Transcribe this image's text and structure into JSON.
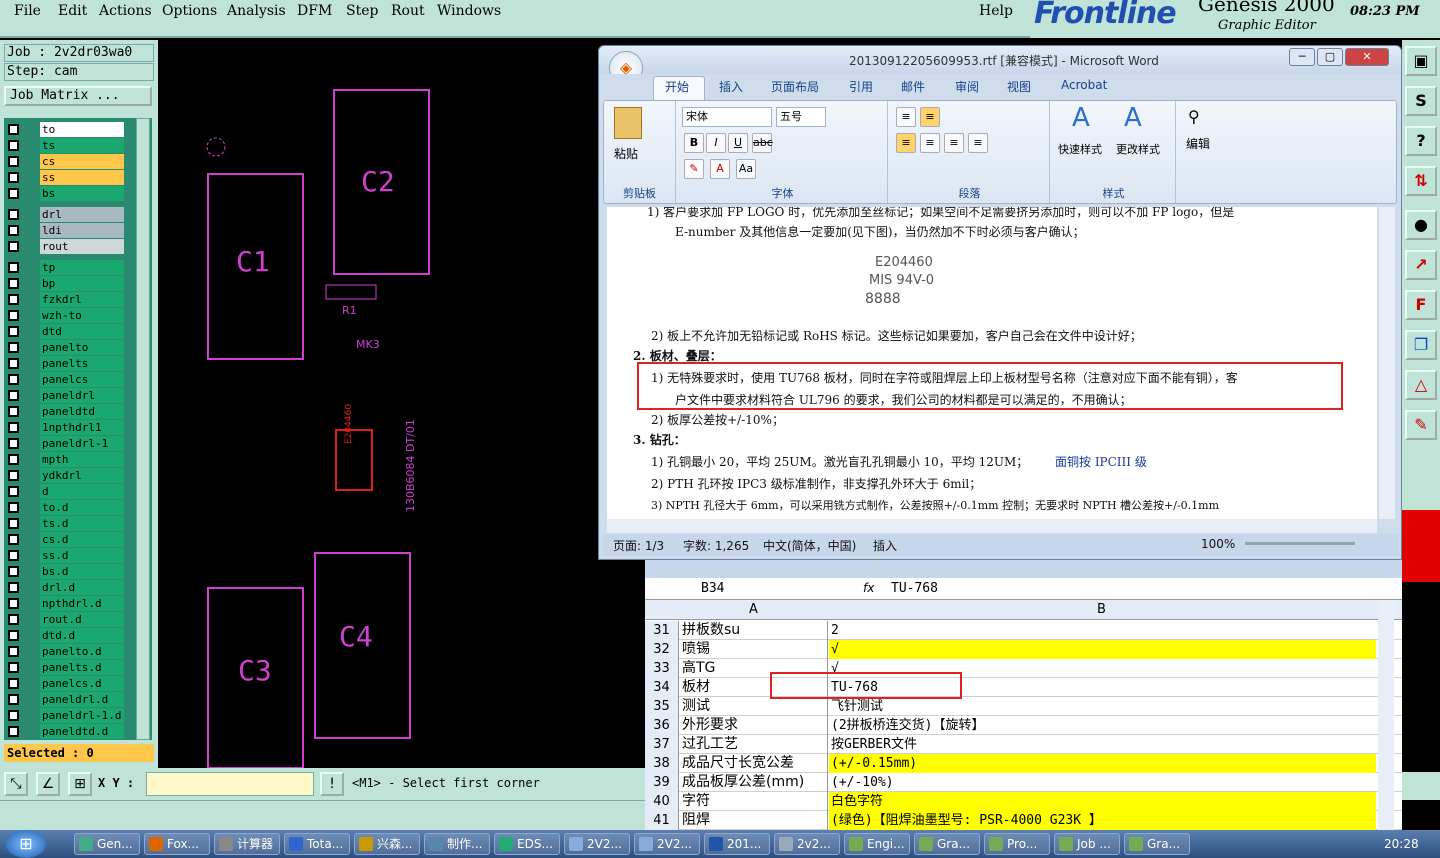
{
  "genesis": {
    "menu": [
      "File",
      "Edit",
      "Actions",
      "Options",
      "Analysis",
      "DFM",
      "Step",
      "Rout",
      "Windows"
    ],
    "help": "Help",
    "logo": "Frontline",
    "product": "Genesis 2000",
    "subtitle": "Graphic Editor",
    "time": "08:23 PM",
    "job_label": "Job : 2v2dr03wa0",
    "step_label": "Step: cam",
    "job_matrix_btn": "Job Matrix ...",
    "selected": "Selected : 0",
    "xy_label": "X Y :",
    "status_msg": "<M1> - Select first corner",
    "layers": [
      {
        "name": "to",
        "color": "#ffffff"
      },
      {
        "name": "ts",
        "color": "#1aa870"
      },
      {
        "name": "cs",
        "color": "#ffc74a"
      },
      {
        "name": "ss",
        "color": "#ffc74a"
      },
      {
        "name": "bs",
        "color": "#1aa870"
      },
      {
        "name": "drl",
        "color": "#a9b9c0"
      },
      {
        "name": "ldi",
        "color": "#a9b9c0"
      },
      {
        "name": "rout",
        "color": "#cfd8d8"
      },
      {
        "name": "tp",
        "color": "#1aa870"
      },
      {
        "name": "bp",
        "color": "#1aa870"
      },
      {
        "name": "fzkdrl",
        "color": "#1aa870"
      },
      {
        "name": "wzh-to",
        "color": "#1aa870"
      },
      {
        "name": "dtd",
        "color": "#1aa870"
      },
      {
        "name": "panelto",
        "color": "#1aa870"
      },
      {
        "name": "panelts",
        "color": "#1aa870"
      },
      {
        "name": "panelcs",
        "color": "#1aa870"
      },
      {
        "name": "paneldrl",
        "color": "#1aa870"
      },
      {
        "name": "paneldtd",
        "color": "#1aa870"
      },
      {
        "name": "1npthdrl1",
        "color": "#1aa870"
      },
      {
        "name": "paneldrl-1",
        "color": "#1aa870"
      },
      {
        "name": "mpth",
        "color": "#1aa870"
      },
      {
        "name": "ydkdrl",
        "color": "#1aa870"
      },
      {
        "name": "d",
        "color": "#1aa870"
      },
      {
        "name": "to.d",
        "color": "#1aa870"
      },
      {
        "name": "ts.d",
        "color": "#1aa870"
      },
      {
        "name": "cs.d",
        "color": "#1aa870"
      },
      {
        "name": "ss.d",
        "color": "#1aa870"
      },
      {
        "name": "bs.d",
        "color": "#1aa870"
      },
      {
        "name": "drl.d",
        "color": "#1aa870"
      },
      {
        "name": "npthdrl.d",
        "color": "#1aa870"
      },
      {
        "name": "rout.d",
        "color": "#1aa870"
      },
      {
        "name": "dtd.d",
        "color": "#1aa870"
      },
      {
        "name": "panelto.d",
        "color": "#1aa870"
      },
      {
        "name": "panelts.d",
        "color": "#1aa870"
      },
      {
        "name": "panelcs.d",
        "color": "#1aa870"
      },
      {
        "name": "paneldrl.d",
        "color": "#1aa870"
      },
      {
        "name": "paneldrl-1.d",
        "color": "#1aa870"
      },
      {
        "name": "paneldtd.d",
        "color": "#1aa870"
      }
    ],
    "canvas_labels": {
      "c1": "C1",
      "c2": "C2",
      "c3": "C3",
      "c4": "C4",
      "r1": "R1",
      "mk3": "MK3",
      "code": "130B6084 DT/01",
      "ul": "E204460"
    }
  },
  "word": {
    "title": "20130912205609953.rtf [兼容模式] - Microsoft Word",
    "tabs": [
      "开始",
      "插入",
      "页面布局",
      "引用",
      "邮件",
      "审阅",
      "视图",
      "Acrobat"
    ],
    "groups": [
      "剪贴板",
      "字体",
      "段落",
      "样式",
      "编辑"
    ],
    "paste": "粘贴",
    "font": "宋体",
    "size": "五号",
    "quick_style": "快速样式",
    "change_style": "更改样式",
    "edit": "编辑",
    "lines": [
      "1) 客户要求加 FP LOGO 时，优先添加至丝标记；如果空间不足需要挤另添加时，则可以不加 FP logo，但是",
      "E-number 及其他信息一定要加(见下图)，当仍然加不下时必须与客户确认；",
      "E204460",
      "MIS 94V-0",
      "8888",
      "2) 板上不允许加无铅标记或 RoHS 标记。这些标记如果要加，客户自己会在文件中设计好；",
      "2.  板材、叠层：",
      "1) 无特殊要求时，使用 TU768 板材，同时在字符或阻焊层上印上板材型号名称（注意对应下面不能有铜），客",
      "户文件中要求材料符合 UL796 的要求，我们公司的材料都是可以满足的，不用确认；",
      "2) 板厚公差按+/-10%；",
      "3.  钻孔：",
      "1) 孔铜最小 20，平均 25UM。激光盲孔孔铜最小 10，平均 12UM；",
      "面铜按 IPCIII 级",
      "2) PTH 孔环按 IPC3 级标准制作，非支撑孔外环大于 6mil；",
      "3) NPTH 孔径大于 6mm，可以采用铣方式制作，公差按照+/-0.1mm 控制；无要求时 NPTH 槽公差按+/-0.1mm"
    ],
    "status": {
      "page": "页面: 1/3",
      "words": "字数: 1,265",
      "lang": "中文(简体，中国)",
      "mode": "插入",
      "zoom": "100%"
    }
  },
  "excel": {
    "cell_ref": "B34",
    "fx": "fx",
    "formula": "TU-768",
    "col_a": "A",
    "col_b": "B",
    "rows": [
      {
        "n": "31",
        "a": "拼板数su",
        "b": "2",
        "y": false
      },
      {
        "n": "32",
        "a": "喷锡",
        "b": "√",
        "y": true
      },
      {
        "n": "33",
        "a": "高TG",
        "b": "√",
        "y": false
      },
      {
        "n": "34",
        "a": "板材",
        "b": "TU-768",
        "y": false
      },
      {
        "n": "35",
        "a": "测试",
        "b": "飞针测试",
        "y": false
      },
      {
        "n": "36",
        "a": "外形要求",
        "b": "(2拼板桥连交货)【旋转】",
        "y": false
      },
      {
        "n": "37",
        "a": "过孔工艺",
        "b": "按GERBER文件",
        "y": false
      },
      {
        "n": "38",
        "a": "成品尺寸长宽公差",
        "b": "(+/-0.15mm)",
        "y": true
      },
      {
        "n": "39",
        "a": "成品板厚公差(mm)",
        "b": "(+/-10%)",
        "y": false
      },
      {
        "n": "40",
        "a": "字符",
        "b": "白色字符",
        "y": true
      },
      {
        "n": "41",
        "a": "阻焊",
        "b": "(绿色)【阻焊油墨型号: PSR-4000 G23K 】",
        "y": true
      }
    ]
  },
  "taskbar": {
    "items": [
      "Gen...",
      "Fox...",
      "计算器",
      "Tota...",
      "兴森...",
      "制作...",
      "EDS...",
      "2V2...",
      "2V2...",
      "201...",
      "2v2...",
      "Engi...",
      "Gra...",
      "Pro...",
      "Job ...",
      "Gra..."
    ],
    "clock": "20:28"
  }
}
